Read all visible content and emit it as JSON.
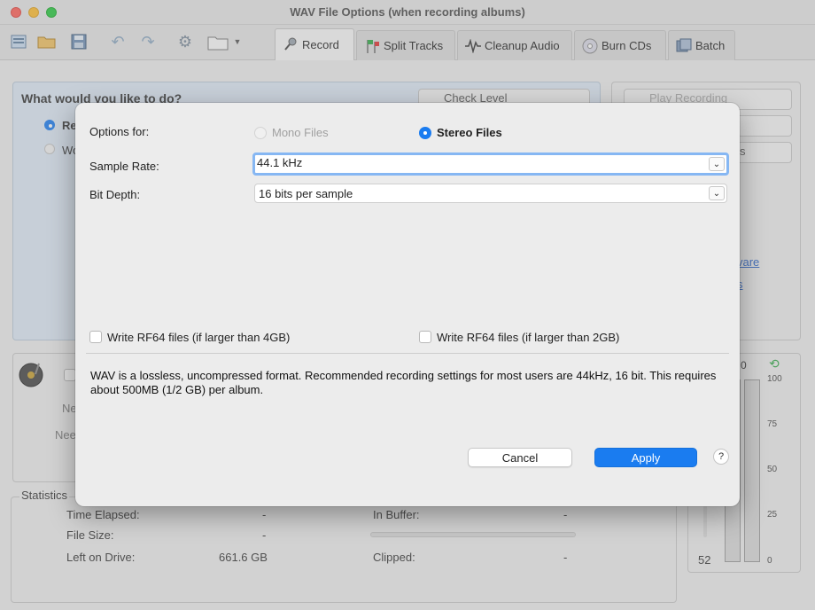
{
  "window": {
    "title": "WAV File Options (when recording albums)"
  },
  "toolbar": {
    "help_label": "?",
    "tabs": [
      {
        "label": "Record",
        "icon": "microphone-icon"
      },
      {
        "label": "Split Tracks",
        "icon": "flags-icon"
      },
      {
        "label": "Cleanup Audio",
        "icon": "waveform-icon"
      },
      {
        "label": "Burn CDs",
        "icon": "cd-icon"
      },
      {
        "label": "Batch",
        "icon": "batch-icon"
      }
    ]
  },
  "background": {
    "question": "What would you like to do?",
    "radio1": "Re",
    "radio2": "Wo",
    "check_level": "Check Level",
    "play_recording": "Play Recording",
    "side_s": "s",
    "side_colon": ":",
    "link1": "vare",
    "link2": "s",
    "nee1": "Nee",
    "nee2": "Nee",
    "statistics": {
      "title": "Statistics",
      "time_elapsed_label": "Time Elapsed:",
      "time_elapsed_value": "-",
      "file_size_label": "File Size:",
      "file_size_value": "-",
      "left_on_drive_label": "Left on Drive:",
      "left_on_drive_value": "661.6 GB",
      "in_buffer_label": "In Buffer:",
      "in_buffer_value": "-",
      "clipped_label": "Clipped:",
      "clipped_value": "-"
    },
    "meter": {
      "top_value": "0",
      "bottom_value": "52",
      "ticks": [
        "100",
        "75",
        "50",
        "25",
        "0"
      ]
    }
  },
  "dialog": {
    "options_for_label": "Options for:",
    "mono_label": "Mono Files",
    "stereo_label": "Stereo Files",
    "selected_option": "Stereo Files",
    "sample_rate_label": "Sample Rate:",
    "sample_rate_value": "44.1 kHz",
    "bit_depth_label": "Bit Depth:",
    "bit_depth_value": "16 bits per sample",
    "rf64_mono_label": "Write RF64 files (if larger than 4GB)",
    "rf64_stereo_label": "Write RF64 files (if larger than 2GB)",
    "description": "WAV is a lossless, uncompressed format.  Recommended recording settings for most users are 44kHz, 16 bit.  This requires about 500MB (1/2 GB) per album.",
    "cancel_label": "Cancel",
    "apply_label": "Apply",
    "help_label": "?"
  },
  "colors": {
    "accent": "#1a7cf0",
    "focus_ring": "#86b7f3",
    "panel_bg": "#dde9f5"
  }
}
